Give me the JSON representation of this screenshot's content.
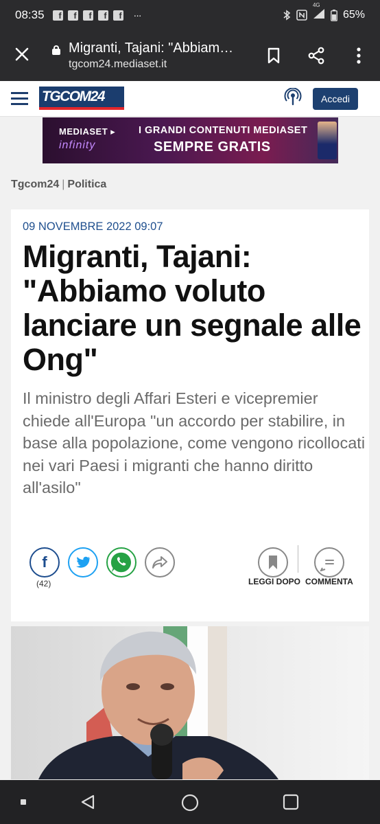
{
  "status": {
    "time": "08:35",
    "notif_icons": [
      "f",
      "f",
      "f",
      "f",
      "f"
    ],
    "more": "···",
    "battery": "65%",
    "network": "4G"
  },
  "browser": {
    "title": "Migranti, Tajani: \"Abbiamo voluto lanciare un segnale alle Ong\"",
    "url": "tgcom24.mediaset.it"
  },
  "site": {
    "logo_text": "TGCOM24",
    "login_label": "Accedi"
  },
  "banner": {
    "brand_top": "MEDIASET ▸",
    "brand_bottom": "infinity",
    "line1": "I GRANDI CONTENUTI MEDIASET",
    "line2": "SEMPRE GRATIS"
  },
  "breadcrumb": {
    "home": "Tgcom24",
    "separator": "|",
    "section": "Politica"
  },
  "article": {
    "date": "09 NOVEMBRE 2022 09:07",
    "headline": "Migranti, Tajani: \"Abbiamo voluto lanciare un segnale alle Ong\"",
    "lead": "Il ministro degli Affari Esteri e vicepremier chiede all'Europa \"un accordo per stabilire, in base alla popolazione, come vengono ricollocati nei vari Paesi i migranti che hanno diritto all'asilo\"",
    "fb_count": "(42)",
    "read_later_label": "LEGGI DOPO",
    "comment_label": "COMMENTA"
  },
  "colors": {
    "brand_blue": "#1d4070",
    "accent_red": "#e3262b",
    "date_blue": "#1f4f8e"
  }
}
